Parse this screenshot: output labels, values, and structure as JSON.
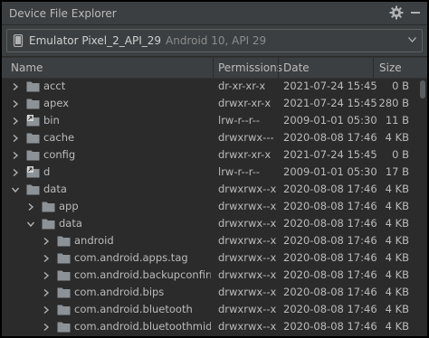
{
  "panel": {
    "title": "Device File Explorer"
  },
  "device": {
    "name": "Emulator Pixel_2_API_29",
    "api": "Android 10, API 29"
  },
  "columns": {
    "name": "Name",
    "permissions": "Permissions",
    "date": "Date",
    "size": "Size"
  },
  "rows": [
    {
      "level": 0,
      "expanded": false,
      "link": false,
      "name": "acct",
      "perm": "dr-xr-xr-x",
      "date": "2021-07-24 15:45",
      "size": "0 B"
    },
    {
      "level": 0,
      "expanded": false,
      "link": false,
      "name": "apex",
      "perm": "drwxr-xr-x",
      "date": "2021-07-24 15:45",
      "size": "280 B"
    },
    {
      "level": 0,
      "expanded": false,
      "link": true,
      "name": "bin",
      "perm": "lrw-r--r--",
      "date": "2009-01-01 05:30",
      "size": "11 B"
    },
    {
      "level": 0,
      "expanded": false,
      "link": false,
      "name": "cache",
      "perm": "drwxrwx---",
      "date": "2020-08-08 17:46",
      "size": "4 KB"
    },
    {
      "level": 0,
      "expanded": false,
      "link": false,
      "name": "config",
      "perm": "drwxr-xr-x",
      "date": "2021-07-24 15:45",
      "size": "0 B"
    },
    {
      "level": 0,
      "expanded": false,
      "link": true,
      "name": "d",
      "perm": "lrw-r--r--",
      "date": "2009-01-01 05:30",
      "size": "17 B"
    },
    {
      "level": 0,
      "expanded": true,
      "link": false,
      "name": "data",
      "perm": "drwxrwx--x",
      "date": "2020-08-08 17:46",
      "size": "4 KB"
    },
    {
      "level": 1,
      "expanded": false,
      "link": false,
      "name": "app",
      "perm": "drwxrwx--x",
      "date": "2020-08-08 17:46",
      "size": "4 KB"
    },
    {
      "level": 1,
      "expanded": true,
      "link": false,
      "name": "data",
      "perm": "drwxrwx--x",
      "date": "2020-08-08 17:46",
      "size": "4 KB"
    },
    {
      "level": 2,
      "expanded": false,
      "link": false,
      "name": "android",
      "perm": "drwxrwx--x",
      "date": "2020-08-08 17:46",
      "size": "4 KB"
    },
    {
      "level": 2,
      "expanded": false,
      "link": false,
      "name": "com.android.apps.tag",
      "perm": "drwxrwx--x",
      "date": "2020-08-08 17:46",
      "size": "4 KB"
    },
    {
      "level": 2,
      "expanded": false,
      "link": false,
      "name": "com.android.backupconfirm",
      "perm": "drwxrwx--x",
      "date": "2020-08-08 17:46",
      "size": "4 KB"
    },
    {
      "level": 2,
      "expanded": false,
      "link": false,
      "name": "com.android.bips",
      "perm": "drwxrwx--x",
      "date": "2020-08-08 17:46",
      "size": "4 KB"
    },
    {
      "level": 2,
      "expanded": false,
      "link": false,
      "name": "com.android.bluetooth",
      "perm": "drwxrwx--x",
      "date": "2020-08-08 17:46",
      "size": "4 KB"
    },
    {
      "level": 2,
      "expanded": false,
      "link": false,
      "name": "com.android.bluetoothmidiser",
      "perm": "drwxrwx--x",
      "date": "2020-08-08 17:46",
      "size": "4 KB"
    }
  ],
  "colors": {
    "panel_bg": "#2b2b2b",
    "toolbar_bg": "#3c3f41",
    "folder": "#8d9296",
    "text": "#bbbbbb"
  },
  "icons": {
    "settings": "gear-icon",
    "minimize": "minimize-icon",
    "device": "phone-icon",
    "folder": "folder-icon",
    "link": "link-icon"
  }
}
